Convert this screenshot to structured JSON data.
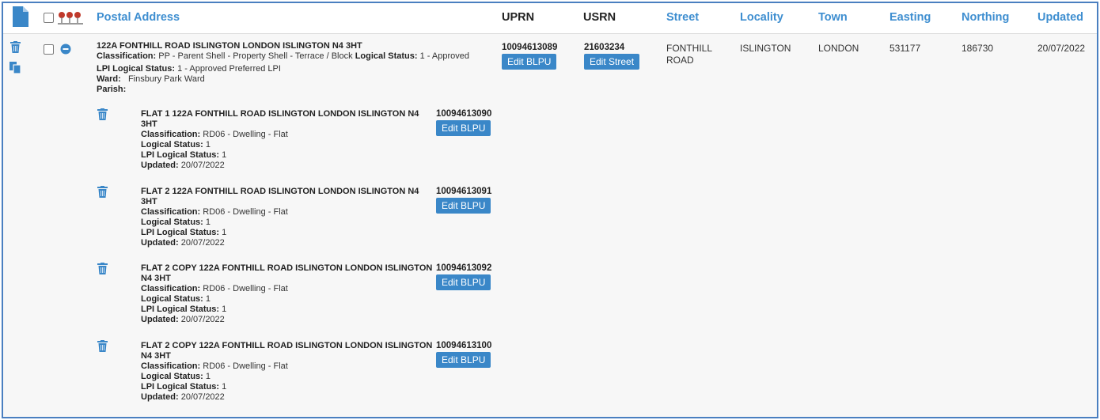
{
  "header": {
    "postal_address": "Postal Address",
    "uprn": "UPRN",
    "usrn": "USRN",
    "street": "Street",
    "locality": "Locality",
    "town": "Town",
    "easting": "Easting",
    "northing": "Northing",
    "updated": "Updated"
  },
  "colors": {
    "accent": "#3e8ed0",
    "button": "#3a87c8",
    "frame": "#4a7fc0"
  },
  "icons": [
    "new-document-icon",
    "select-all-checkbox",
    "map-pins-icon",
    "trash-icon",
    "copy-icon",
    "collapse-icon"
  ],
  "parent": {
    "title": "122A FONTHILL ROAD ISLINGTON LONDON ISLINGTON N4 3HT",
    "classification_label": "Classification:",
    "classification": "PP - Parent Shell - Property Shell - Terrace / Block",
    "logical_status_label": "Logical Status:",
    "logical_status": "1 - Approved",
    "lpi_status_label": "LPI Logical Status:",
    "lpi_status": "1 - Approved Preferred LPI",
    "ward_label": "Ward:",
    "ward": "Finsbury Park Ward",
    "parish_label": "Parish:",
    "uprn": "10094613089",
    "edit_blpu": "Edit BLPU",
    "usrn": "21603234",
    "edit_street": "Edit Street",
    "street": "FONTHILL ROAD",
    "locality": "ISLINGTON",
    "town": "LONDON",
    "easting": "531177",
    "northing": "186730",
    "updated": "20/07/2022"
  },
  "children": [
    {
      "title": "FLAT 1 122A FONTHILL ROAD ISLINGTON LONDON ISLINGTON N4 3HT",
      "classification_label": "Classification:",
      "classification": "RD06 - Dwelling - Flat",
      "logical_status_label": "Logical Status:",
      "logical_status": "1",
      "lpi_status_label": "LPI Logical Status:",
      "lpi_status": "1",
      "updated_label": "Updated:",
      "updated": "20/07/2022",
      "uprn": "10094613090",
      "edit_blpu": "Edit BLPU"
    },
    {
      "title": "FLAT 2 122A FONTHILL ROAD ISLINGTON LONDON ISLINGTON N4 3HT",
      "classification_label": "Classification:",
      "classification": "RD06 - Dwelling - Flat",
      "logical_status_label": "Logical Status:",
      "logical_status": "1",
      "lpi_status_label": "LPI Logical Status:",
      "lpi_status": "1",
      "updated_label": "Updated:",
      "updated": "20/07/2022",
      "uprn": "10094613091",
      "edit_blpu": "Edit BLPU"
    },
    {
      "title": "FLAT 2 COPY 122A FONTHILL ROAD ISLINGTON LONDON ISLINGTON N4 3HT",
      "classification_label": "Classification:",
      "classification": "RD06 - Dwelling - Flat",
      "logical_status_label": "Logical Status:",
      "logical_status": "1",
      "lpi_status_label": "LPI Logical Status:",
      "lpi_status": "1",
      "updated_label": "Updated:",
      "updated": "20/07/2022",
      "uprn": "10094613092",
      "edit_blpu": "Edit BLPU"
    },
    {
      "title": "FLAT 2 COPY 122A FONTHILL ROAD ISLINGTON LONDON ISLINGTON N4 3HT",
      "classification_label": "Classification:",
      "classification": "RD06 - Dwelling - Flat",
      "logical_status_label": "Logical Status:",
      "logical_status": "1",
      "lpi_status_label": "LPI Logical Status:",
      "lpi_status": "1",
      "updated_label": "Updated:",
      "updated": "20/07/2022",
      "uprn": "10094613100",
      "edit_blpu": "Edit BLPU"
    }
  ]
}
